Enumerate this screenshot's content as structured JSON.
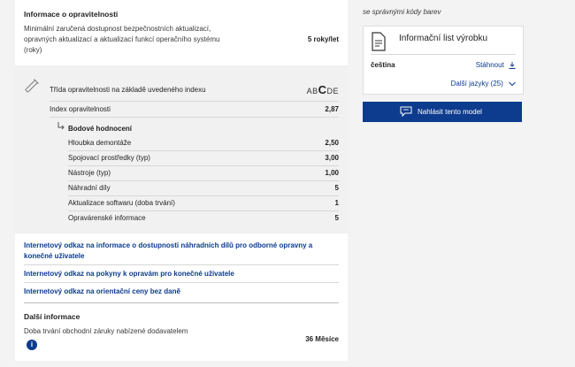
{
  "availability": {
    "title": "Informace o opravitelnosti",
    "description": "Minimální zaručená dostupnost bezpečnostních aktualizací, opravných aktualizací a aktualizací funkcí operačního systému (roky)",
    "value": "5 roky/let"
  },
  "repairability": {
    "class_label": "Třída opravitelnosti na základě uvedeného indexu",
    "class_scale": [
      "A",
      "B",
      "C",
      "D",
      "E"
    ],
    "class_selected": "C",
    "index_label": "Index opravitelnosti",
    "index_value": "2,87",
    "points_title": "Bodové hodnocení",
    "criteria": [
      {
        "label": "Hloubka demontáže",
        "value": "2,50"
      },
      {
        "label": "Spojovací prostředky (typ)",
        "value": "3,00"
      },
      {
        "label": "Nástroje (typ)",
        "value": "1,00"
      },
      {
        "label": "Náhradní díly",
        "value": "5"
      },
      {
        "label": "Aktualizace softwaru (doba trvání)",
        "value": "1"
      },
      {
        "label": "Opravárenské informace",
        "value": "5"
      }
    ]
  },
  "links": [
    "Internetový odkaz na informace o dostupnosti náhradních dílů pro odborné opravny a konečné uživatele",
    "Internetový odkaz na pokyny k opravám pro konečné uživatele",
    "Internetový odkaz na orientační ceny bez daně"
  ],
  "more_info": {
    "title": "Další informace",
    "warranty_label": "Doba trvání obchodní záruky nabízené dodavatelem",
    "warranty_value": "36 Měsíce",
    "info_icon": "i"
  },
  "sidebar": {
    "note": "se správnými kódy barev",
    "card_title": "Informační list výrobku",
    "language": "čeština",
    "download_label": "Stáhnout",
    "more_languages": "Další jazyky (25)",
    "report_button": "Nahlásit tento model"
  }
}
